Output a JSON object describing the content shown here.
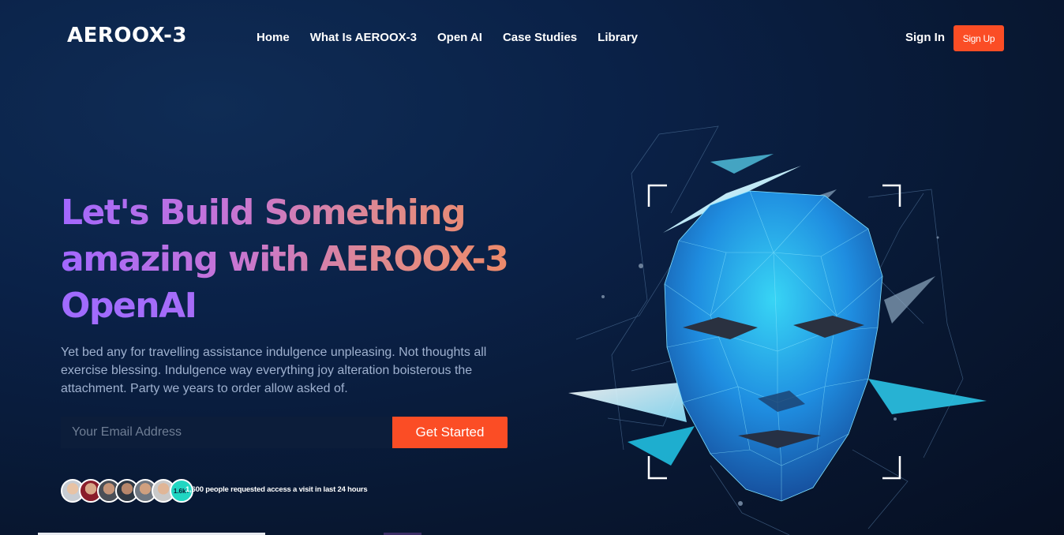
{
  "header": {
    "logo": "AEROOX-3",
    "nav": [
      "Home",
      "What Is AEROOX-3",
      "Open AI",
      "Case Studies",
      "Library"
    ],
    "sign_in": "Sign In",
    "sign_up": "Sign Up"
  },
  "hero": {
    "headline_lines": [
      "Let's Build Something",
      "amazing with AEROOX-3",
      "OpenAI"
    ],
    "description": "Yet bed any for travelling assistance indulgence unpleasing. Not thoughts all exercise blessing. Indulgence way everything joy alteration boisterous the attachment. Party we years to order allow asked of.",
    "email_placeholder": "Your Email Address",
    "cta": "Get Started",
    "avatar_count_badge": "1.6k+",
    "social_proof": "1,600 people requested access a visit in last 24 hours"
  },
  "colors": {
    "accent": "#fb4d25",
    "background": "#0a1f44",
    "badge": "#21d6c2"
  },
  "icons": [
    "polygon-face-illustration",
    "avatar"
  ]
}
